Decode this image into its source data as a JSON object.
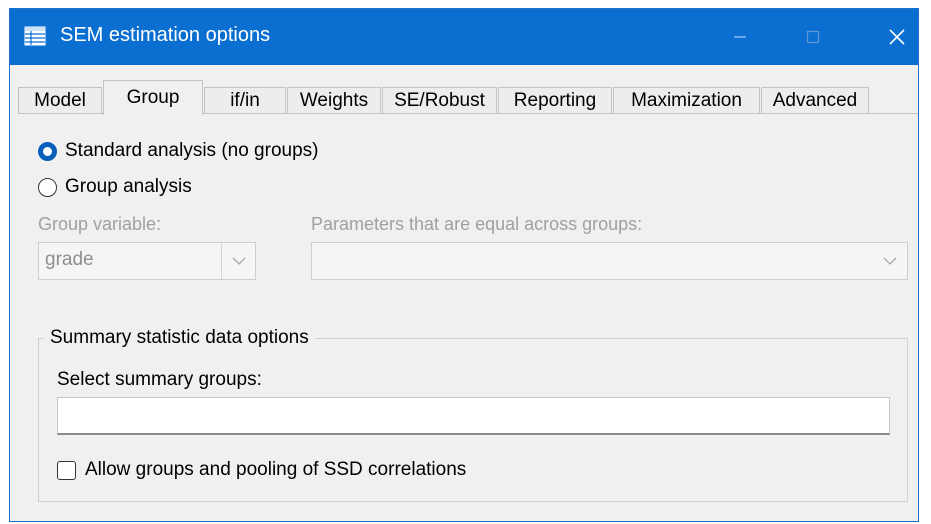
{
  "window": {
    "title": "SEM estimation options",
    "icons": {
      "app": "table-icon",
      "minimize": "minimize-icon",
      "maximize": "maximize-icon",
      "close": "close-icon"
    },
    "colors": {
      "titlebar": "#0a6fd0",
      "accent": "#0a5fbd"
    }
  },
  "tabs": [
    {
      "label": "Model"
    },
    {
      "label": "Group",
      "active": true
    },
    {
      "label": "if/in"
    },
    {
      "label": "Weights"
    },
    {
      "label": "SE/Robust"
    },
    {
      "label": "Reporting"
    },
    {
      "label": "Maximization"
    },
    {
      "label": "Advanced"
    }
  ],
  "analysis": {
    "standard_label": "Standard analysis (no groups)",
    "standard_selected": true,
    "group_label": "Group analysis",
    "group_selected": false
  },
  "group_variable": {
    "label": "Group variable:",
    "value": "grade",
    "enabled": false
  },
  "parameters_equal": {
    "label": "Parameters that are equal across groups:",
    "value": "",
    "enabled": false
  },
  "summary": {
    "title": "Summary statistic data options",
    "select_label": "Select summary groups:",
    "select_value": "",
    "allow_label": "Allow groups and pooling of SSD correlations",
    "allow_checked": false
  }
}
